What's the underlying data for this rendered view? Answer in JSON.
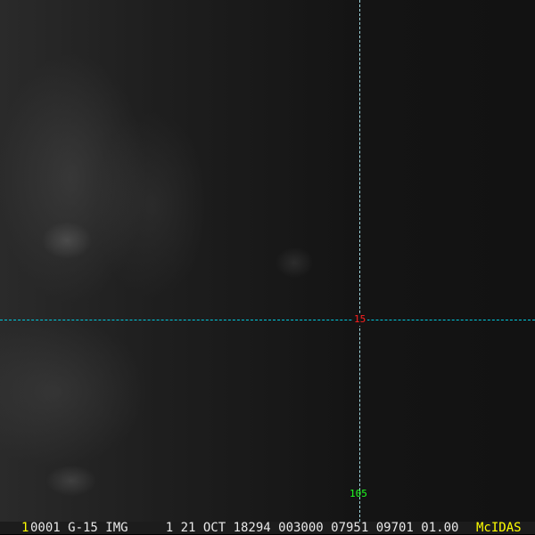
{
  "overlay": {
    "latitude_label": "15",
    "longitude_label": "105"
  },
  "status_bar": {
    "frame_number": "1",
    "info": "0001 G-15 IMG     1 21 OCT 18294 003000 07951 09701 01.00",
    "logo": "McIDAS"
  },
  "colors": {
    "lat_line": "#00c8dc",
    "lat_label": "#ff2020",
    "lon_label": "#20ff20",
    "logo": "#ffff00"
  }
}
